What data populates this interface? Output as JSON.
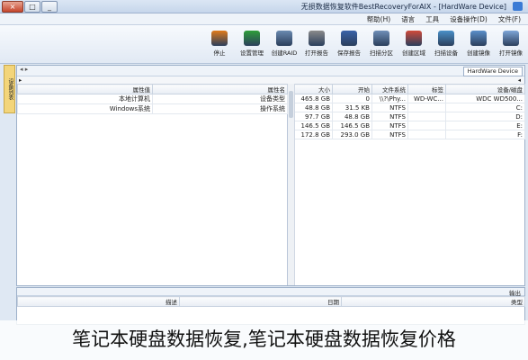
{
  "window": {
    "title": "无损数据恢复软件BestRecoveryForAIX - [HardWare Device]",
    "buttons": {
      "close": "×",
      "maximize": "□",
      "minimize": "_"
    }
  },
  "menu": [
    "文件(F)",
    "设备操作(D)",
    "工具",
    "语言",
    "帮助(H)"
  ],
  "toolbar": [
    {
      "label": "打开镜像",
      "icon": "open-image-icon",
      "color": "#7ea6d8"
    },
    {
      "label": "创建镜像",
      "icon": "create-image-icon",
      "color": "#5a8fc9"
    },
    {
      "label": "扫描设备",
      "icon": "scan-device-icon",
      "color": "#4a90c8"
    },
    {
      "label": "创建区域",
      "icon": "create-region-icon",
      "color": "#d04a3a"
    },
    {
      "label": "扫描分区",
      "icon": "scan-partition-icon",
      "color": "#6f8fb8"
    },
    {
      "label": "保存报告",
      "icon": "save-report-icon",
      "color": "#3a62a8"
    },
    {
      "label": "打开报告",
      "icon": "open-report-icon",
      "color": "#8a8a8a"
    },
    {
      "label": "创建RAID",
      "icon": "create-raid-icon",
      "color": "#6a8ab0"
    },
    {
      "label": "设置管理",
      "icon": "settings-icon",
      "color": "#2f9e3a"
    },
    {
      "label": "停止",
      "icon": "stop-icon",
      "color": "#e07a1a"
    }
  ],
  "sidetab": "设备列表",
  "address": {
    "tab": "HardWare Device",
    "arrows": "◂ ▸"
  },
  "left_headers": {
    "property": "属性值",
    "name": "属性名"
  },
  "left_rows": [
    {
      "value": "本地计算机",
      "name": "设备类型"
    },
    {
      "value": "Windows系统",
      "name": "操作系统"
    }
  ],
  "right_headers": [
    "设备/磁盘",
    "标签",
    "文件系统",
    "开始",
    "大小"
  ],
  "right_rows": [
    {
      "device": "WDC WD500...",
      "label": "WD-WC...",
      "fs": "\\\\?\\Phy...",
      "start": "0",
      "size": "465.8 GB"
    },
    {
      "device": "C:",
      "label": "",
      "fs": "NTFS",
      "start": "31.5 KB",
      "size": "48.8 GB"
    },
    {
      "device": "D:",
      "label": "",
      "fs": "NTFS",
      "start": "48.8 GB",
      "size": "97.7 GB"
    },
    {
      "device": "E:",
      "label": "",
      "fs": "NTFS",
      "start": "146.5 GB",
      "size": "146.5 GB"
    },
    {
      "device": "F:",
      "label": "",
      "fs": "NTFS",
      "start": "293.0 GB",
      "size": "172.8 GB"
    }
  ],
  "output": {
    "title": "输出",
    "cols": [
      "类型",
      "日期",
      "描述"
    ]
  },
  "caption": "笔记本硬盘数据恢复,笔记本硬盘数据恢复价格"
}
